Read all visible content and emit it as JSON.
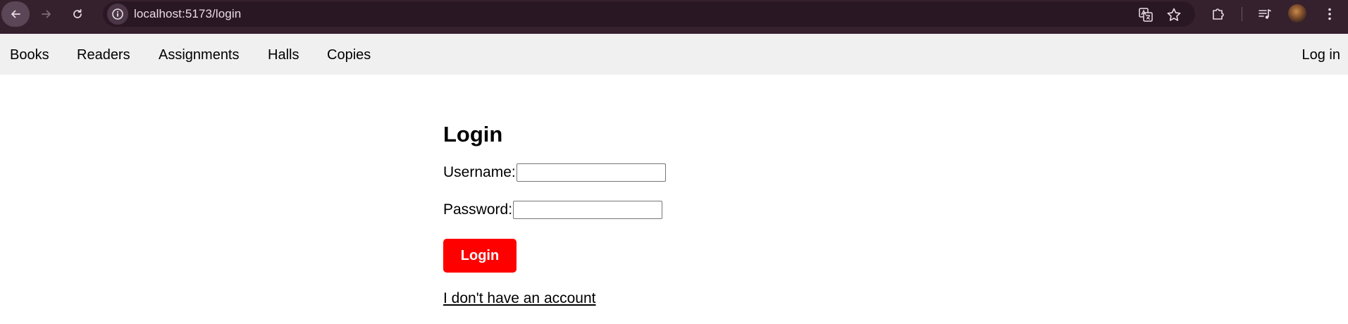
{
  "browser": {
    "url": "localhost:5173/login",
    "icons": {
      "back": "arrow-left-icon",
      "forward": "arrow-right-icon",
      "reload": "reload-icon",
      "site_info": "info-icon",
      "translate": "translate-icon",
      "bookmark": "star-icon",
      "extensions": "puzzle-icon",
      "media": "media-queue-icon",
      "profile": "avatar",
      "menu": "kebab-menu-icon"
    },
    "colors": {
      "toolbar": "#35202e",
      "address_bar": "#2a1724"
    }
  },
  "navbar": {
    "items": [
      {
        "label": "Books"
      },
      {
        "label": "Readers"
      },
      {
        "label": "Assignments"
      },
      {
        "label": "Halls"
      },
      {
        "label": "Copies"
      }
    ],
    "login_label": "Log in",
    "background": "#f0f0f0"
  },
  "login_form": {
    "title": "Login",
    "username_label": "Username:",
    "username_value": "",
    "password_label": "Password:",
    "password_value": "",
    "submit_label": "Login",
    "register_link": "I don't have an account",
    "accent_color": "#ff0000"
  }
}
